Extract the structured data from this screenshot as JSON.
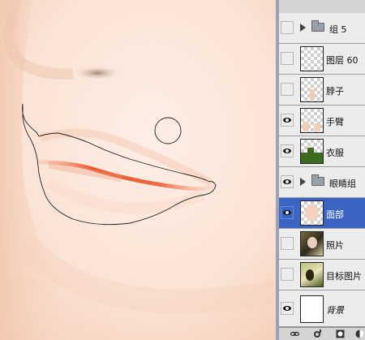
{
  "canvas": {
    "skin_color": "#fbe7dc",
    "lip_color": "#e8572e",
    "tools": [
      "lasso-selection",
      "circle-brush-cursor"
    ]
  },
  "layers_panel": {
    "layers": [
      {
        "label": "组 5",
        "type": "group",
        "visible": false
      },
      {
        "label": "图层 60",
        "type": "layer",
        "visible": false
      },
      {
        "label": "脖子",
        "type": "layer",
        "visible": false
      },
      {
        "label": "手臂",
        "type": "layer",
        "visible": true
      },
      {
        "label": "衣服",
        "type": "layer",
        "visible": true
      },
      {
        "label": "眼睛组",
        "type": "group",
        "visible": true
      },
      {
        "label": "面部",
        "type": "layer",
        "visible": true,
        "selected": true
      },
      {
        "label": "照片",
        "type": "layer",
        "visible": false
      },
      {
        "label": "目标图片",
        "type": "layer",
        "visible": false
      },
      {
        "label": "背景",
        "type": "layer",
        "visible": true
      }
    ],
    "bottom_icons": [
      "link-icon",
      "fx-icon",
      "mask-icon",
      "adjustment-icon"
    ],
    "selection_color": "#3b64c4"
  }
}
